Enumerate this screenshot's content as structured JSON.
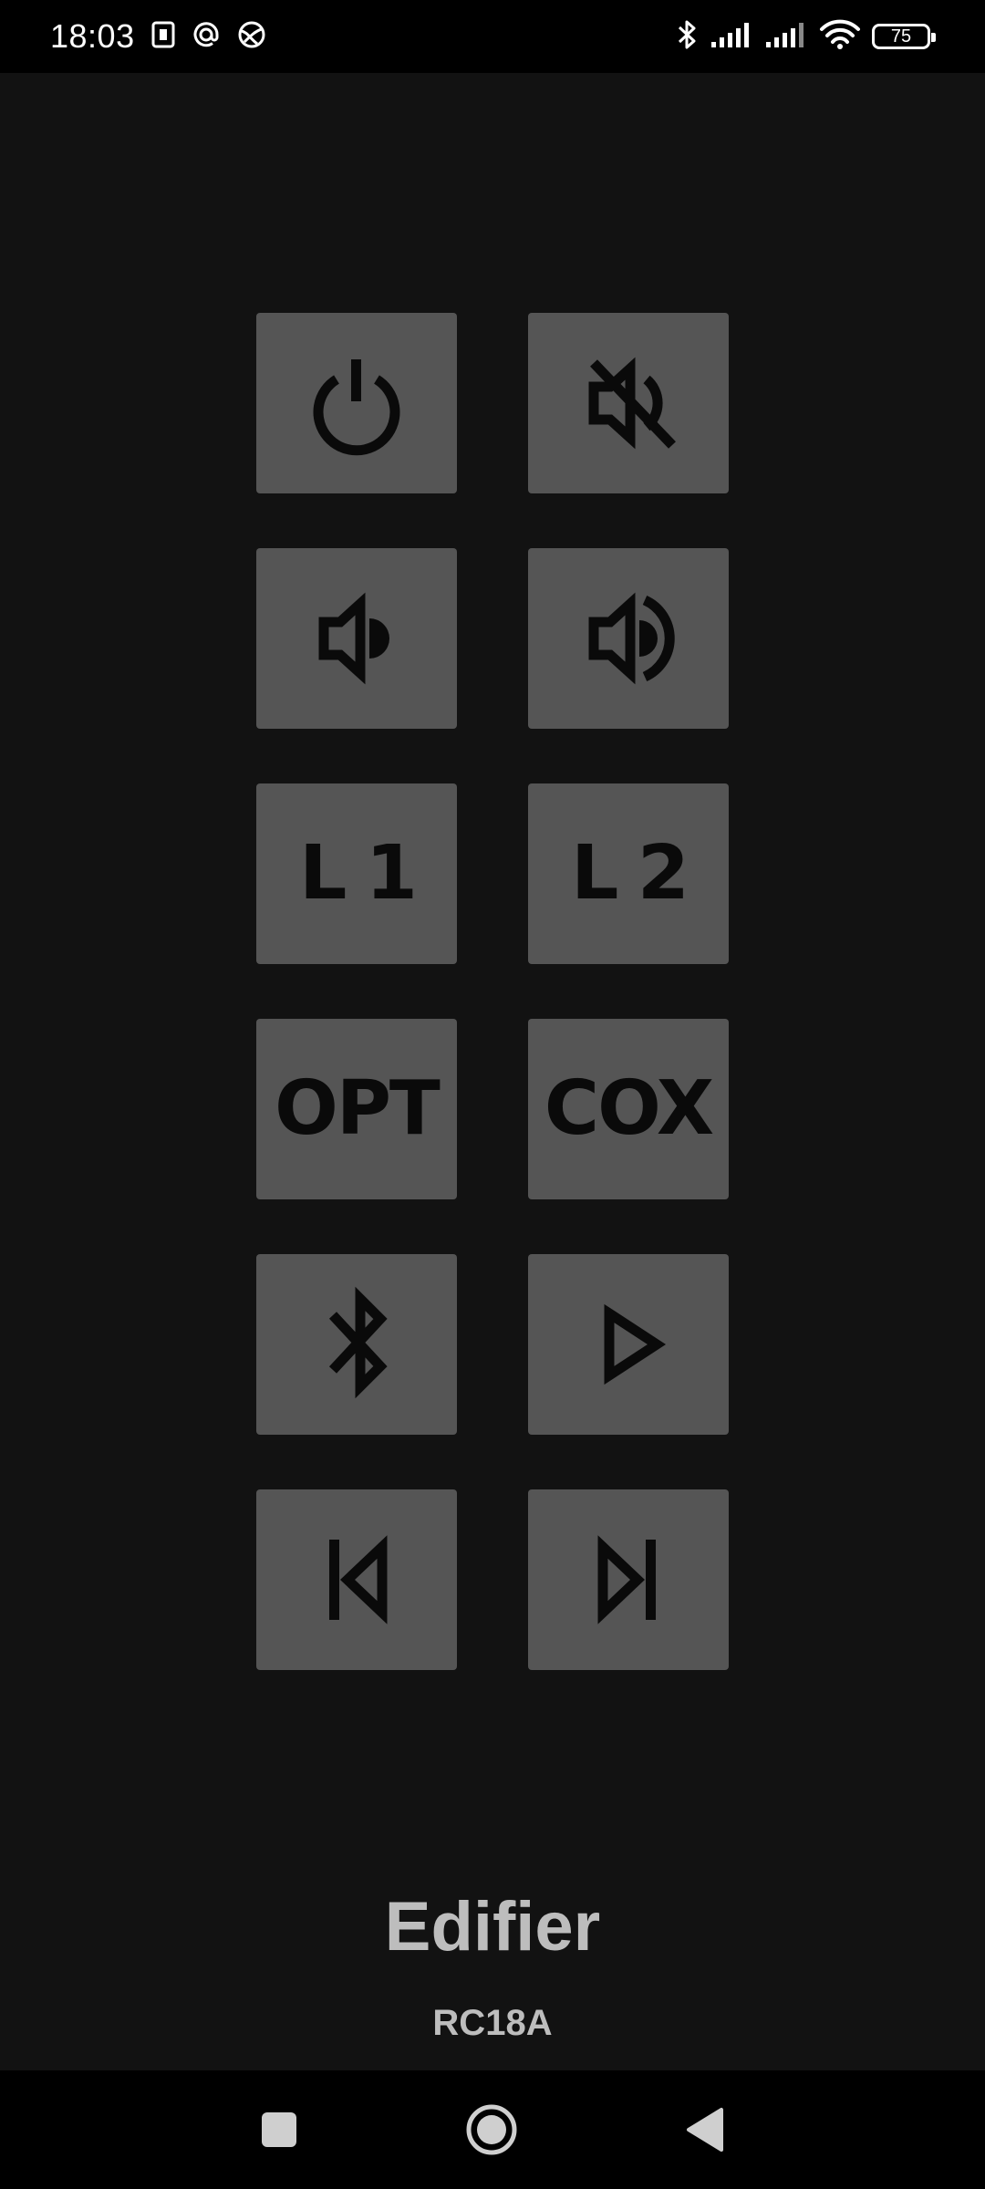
{
  "status_bar": {
    "time": "18:03",
    "battery": "75",
    "left_icons": [
      "sim-card-icon",
      "at-sign-icon",
      "globe-icon"
    ],
    "right_icons": [
      "bluetooth-icon",
      "signal-icon",
      "signal-icon",
      "wifi-icon",
      "battery-icon"
    ]
  },
  "buttons": [
    {
      "icon": "power-icon"
    },
    {
      "icon": "mute-icon"
    },
    {
      "icon": "volume-down-icon"
    },
    {
      "icon": "volume-up-icon"
    },
    {
      "label": "L 1"
    },
    {
      "label": "L 2"
    },
    {
      "label": "OPT"
    },
    {
      "label": "COX"
    },
    {
      "icon": "bluetooth-icon"
    },
    {
      "icon": "play-icon"
    },
    {
      "icon": "previous-track-icon"
    },
    {
      "icon": "next-track-icon"
    }
  ],
  "brand": "Edifier",
  "model": "RC18A",
  "nav_bar": [
    "recents-icon",
    "home-icon",
    "back-icon"
  ],
  "colors": {
    "background": "#121212",
    "button": "#555555",
    "button_glyph": "#0a0a0a",
    "brand_text": "#bdbdbd",
    "bars": "#000000"
  }
}
